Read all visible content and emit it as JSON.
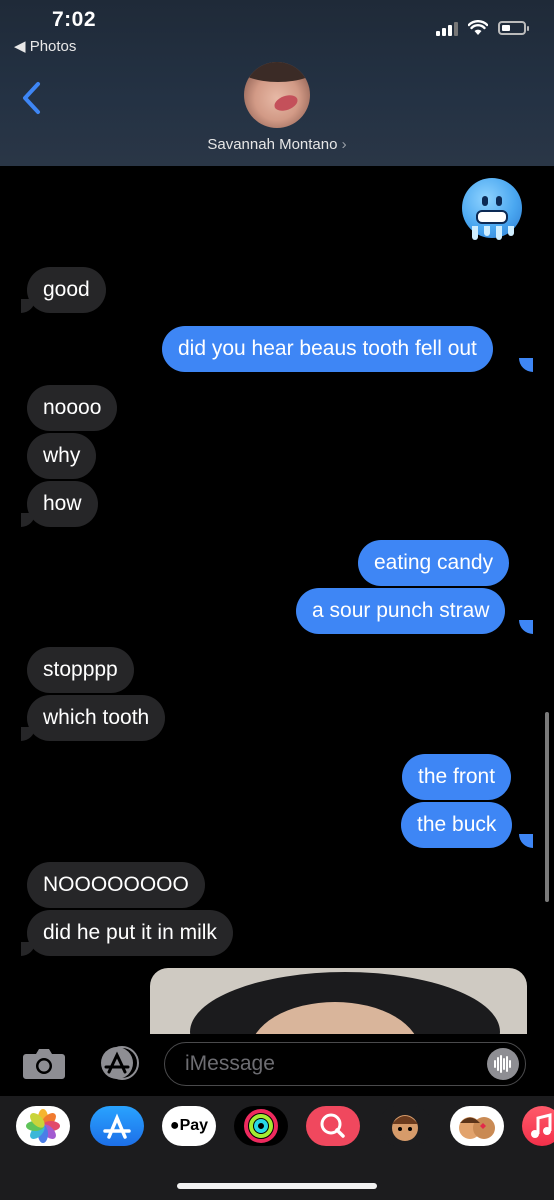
{
  "status_bar": {
    "time": "7:02",
    "back_app": "◀ Photos"
  },
  "contact": {
    "name": "Savannah Montano",
    "chevron": "›"
  },
  "messages": [
    {
      "text": "good",
      "dir": "in"
    },
    {
      "text": "did you hear beaus tooth fell out",
      "dir": "out"
    },
    {
      "text": "noooo",
      "dir": "in"
    },
    {
      "text": "why",
      "dir": "in"
    },
    {
      "text": "how",
      "dir": "in"
    },
    {
      "text": "eating candy",
      "dir": "out"
    },
    {
      "text": "a sour punch straw",
      "dir": "out"
    },
    {
      "text": "stopppp",
      "dir": "in"
    },
    {
      "text": "which tooth",
      "dir": "in"
    },
    {
      "text": "the front",
      "dir": "out"
    },
    {
      "text": "the buck",
      "dir": "out"
    },
    {
      "text": "NOOOOOOOO",
      "dir": "in"
    },
    {
      "text": "did he put it in milk",
      "dir": "in"
    }
  ],
  "input": {
    "placeholder": "iMessage"
  },
  "drawer": {
    "apple_pay_label": "Pay"
  },
  "colors": {
    "outgoing": "#3e86f5",
    "incoming": "#262628",
    "accent": "#3e86f5"
  }
}
